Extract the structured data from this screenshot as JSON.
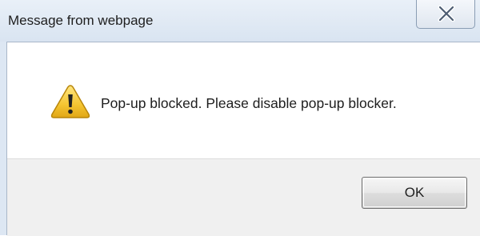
{
  "window": {
    "title": "Message from webpage",
    "close_icon": "close-x-icon"
  },
  "dialog": {
    "icon": "warning-icon",
    "message": "Pop-up blocked. Please disable pop-up blocker.",
    "ok_label": "OK"
  },
  "colors": {
    "titlebar": "#dde7f3",
    "content_bg": "#ffffff",
    "footer_bg": "#f0f0f0",
    "warning_yellow": "#f3c43a"
  }
}
